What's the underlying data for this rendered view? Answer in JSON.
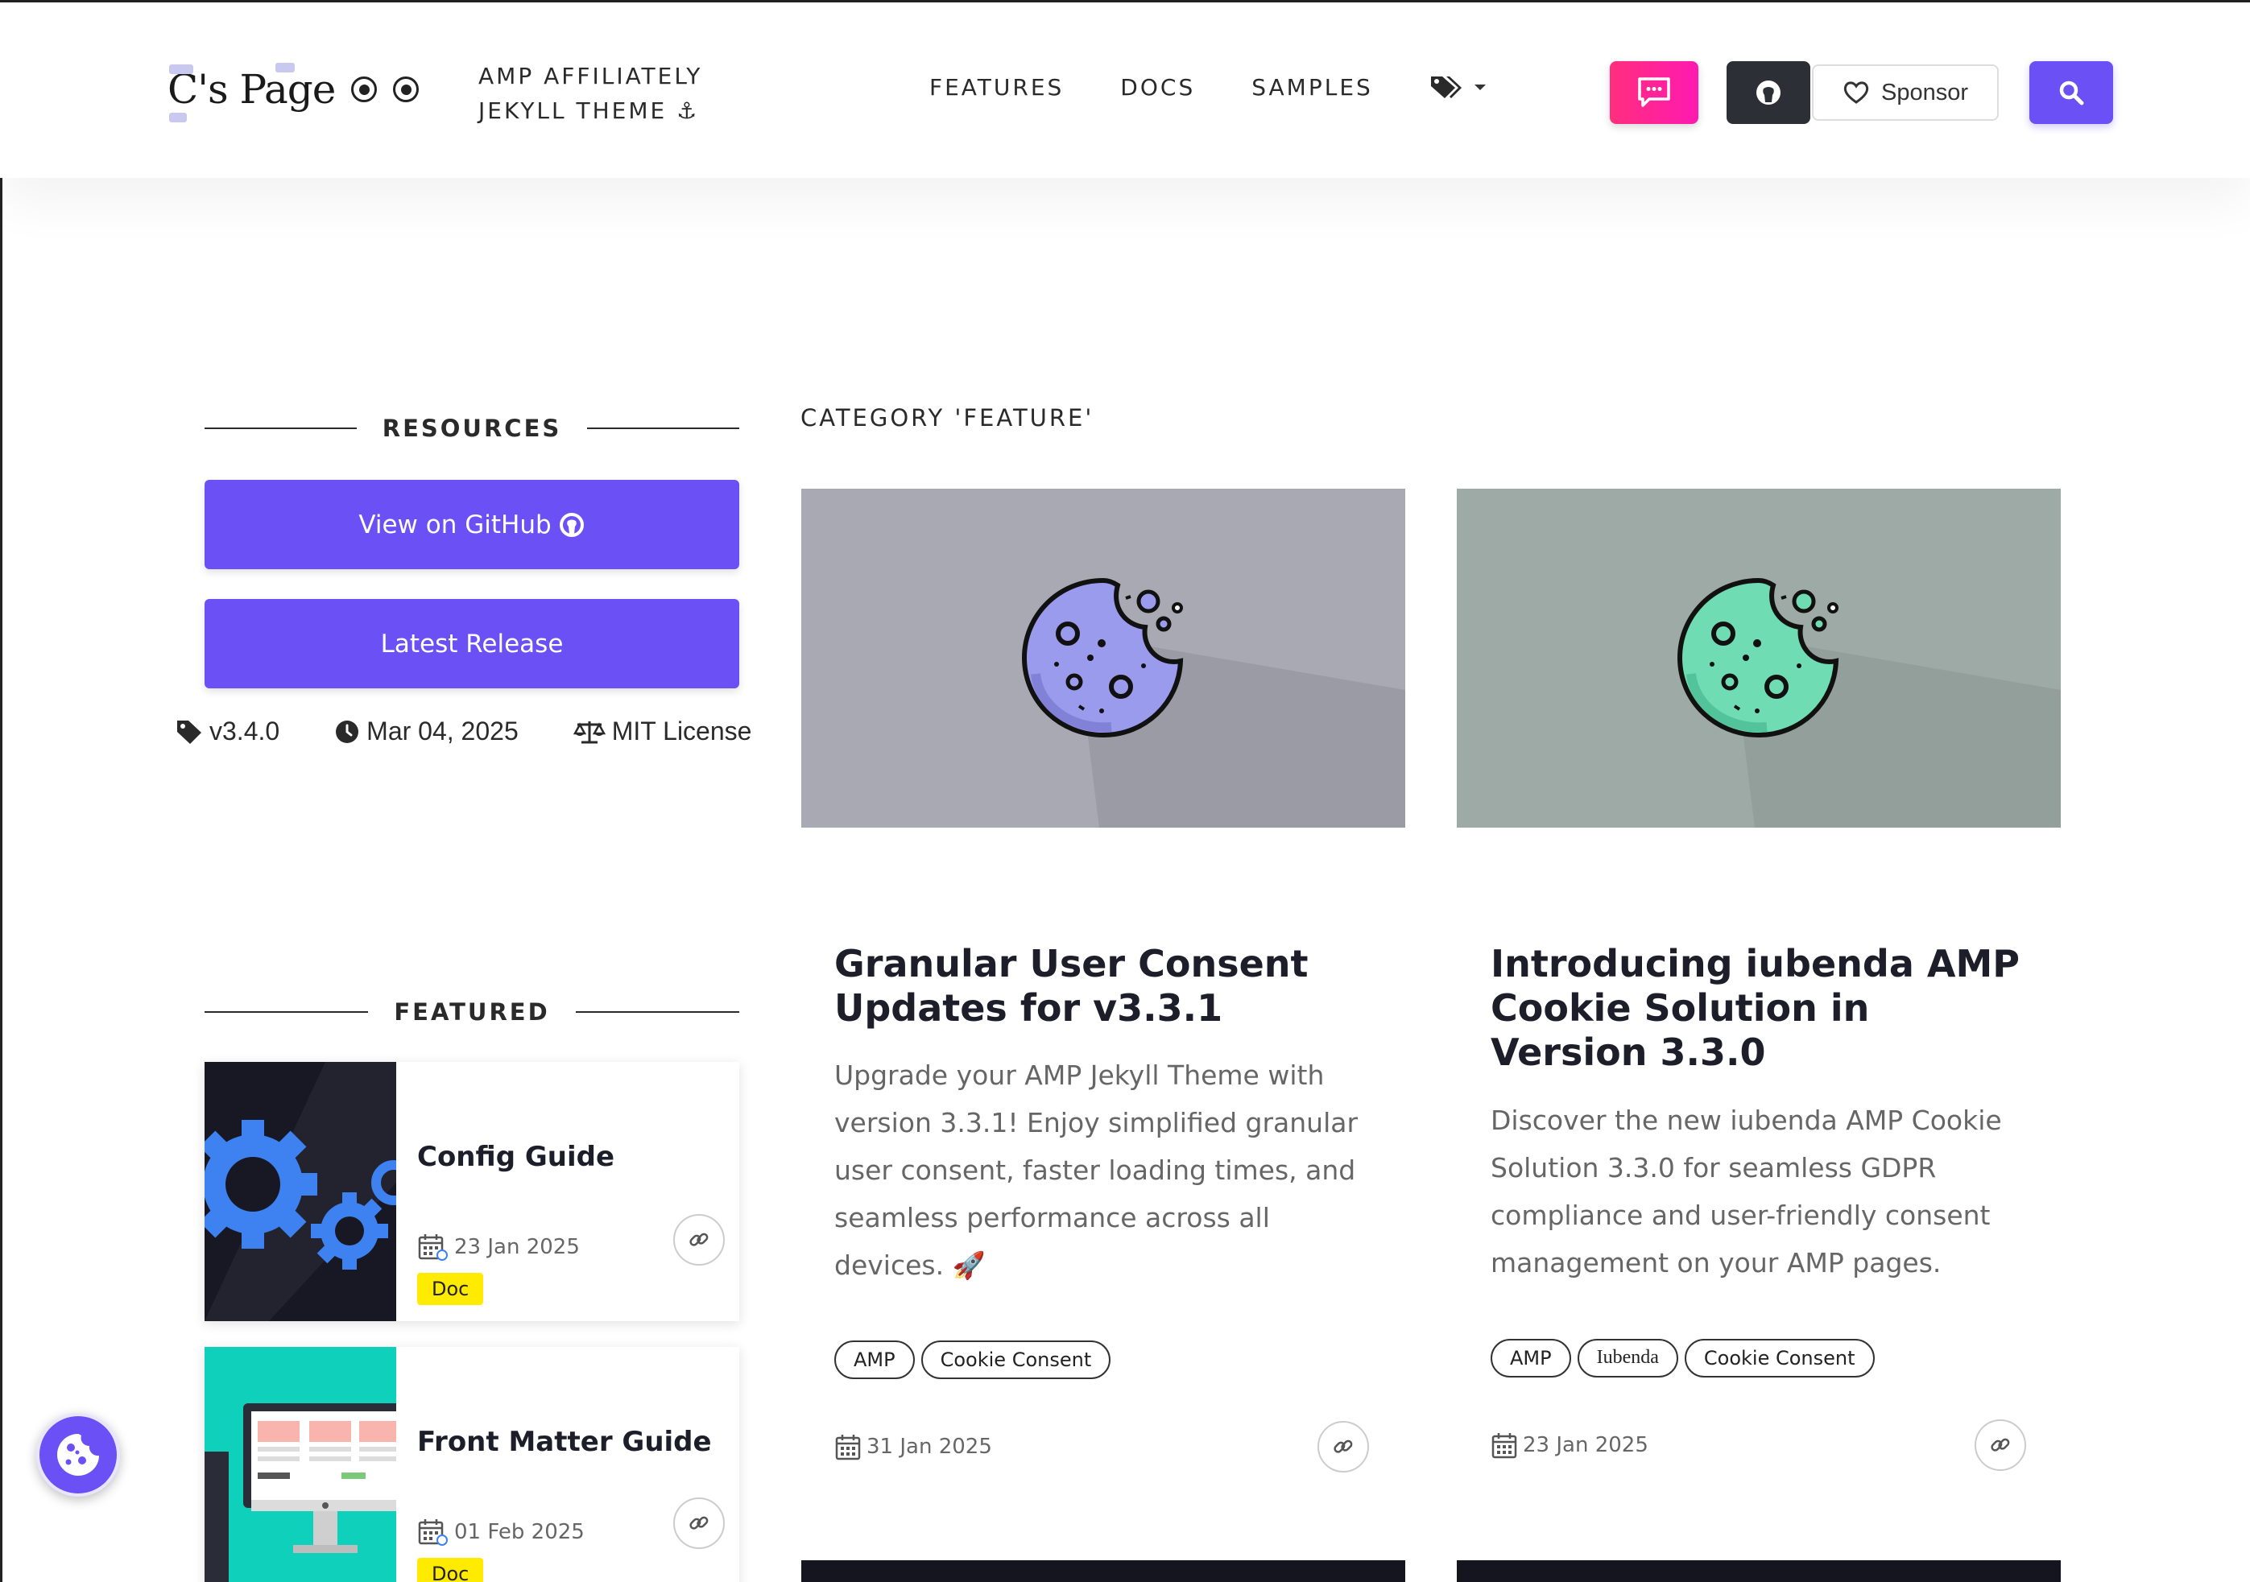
{
  "header": {
    "logo_text": "C's Page",
    "tagline_line1": "AMP AFFILIATELY",
    "tagline_line2": "JEKYLL THEME ⚓",
    "nav": [
      "FEATURES",
      "DOCS",
      "SAMPLES"
    ],
    "sponsor_label": "Sponsor"
  },
  "sidebar": {
    "resources_title": "RESOURCES",
    "github_button": "View on GitHub",
    "release_button": "Latest Release",
    "version": "v3.4.0",
    "release_date": "Mar 04, 2025",
    "license": "MIT License",
    "featured_title": "FEATURED",
    "featured": [
      {
        "title": "Config Guide",
        "date": "23 Jan 2025",
        "badge": "Doc"
      },
      {
        "title": "Front Matter Guide",
        "date": "01 Feb 2025",
        "badge": "Doc"
      }
    ]
  },
  "main": {
    "category_title": "CATEGORY 'FEATURE'",
    "posts": [
      {
        "title": "Granular User Consent Updates for v3.3.1",
        "excerpt": "Upgrade your AMP Jekyll Theme with version 3.3.1! Enjoy simplified granular user consent, faster loading times, and seamless performance across all devices. 🚀",
        "tags": [
          "AMP",
          "Cookie Consent"
        ],
        "date": "31 Jan 2025",
        "cookie_color": "#9b9bee",
        "bg_color": "#a8a9b3"
      },
      {
        "title": "Introducing iubenda AMP Cookie Solution in Version 3.3.0",
        "excerpt": "Discover the new iubenda AMP Cookie Solution 3.3.0 for seamless GDPR compliance and user-friendly consent management on your AMP pages.",
        "tags": [
          "AMP",
          "Iubenda",
          "Cookie Consent"
        ],
        "date": "23 Jan 2025",
        "cookie_color": "#6fdcb3",
        "bg_color": "#9eaaa6"
      }
    ]
  },
  "colors": {
    "accent": "#6b50f5",
    "chat_gradient": "#ff2e7e",
    "badge_yellow": "#ffeb00"
  }
}
